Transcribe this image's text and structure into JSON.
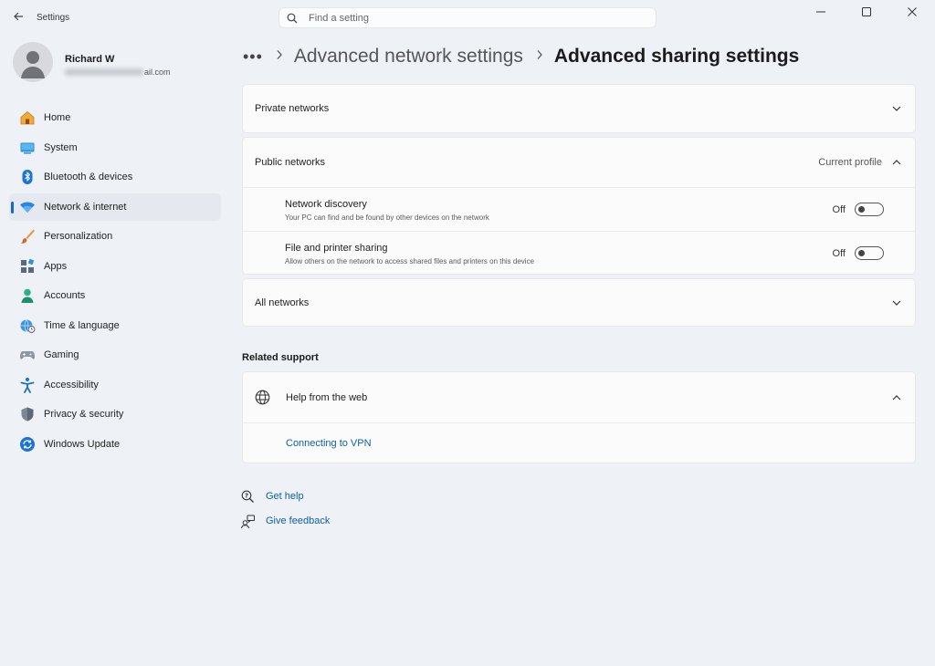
{
  "window": {
    "title": "Settings",
    "back_icon": "back-arrow-icon",
    "controls": [
      "minimize-icon",
      "maximize-icon",
      "close-icon"
    ]
  },
  "search": {
    "placeholder": "Find a setting"
  },
  "profile": {
    "name": "Richard W",
    "email_visible": "ail.com"
  },
  "sidebar": {
    "items": [
      {
        "label": "Home",
        "icon": "home-icon"
      },
      {
        "label": "System",
        "icon": "system-icon"
      },
      {
        "label": "Bluetooth & devices",
        "icon": "bluetooth-icon"
      },
      {
        "label": "Network & internet",
        "icon": "wifi-icon",
        "active": true
      },
      {
        "label": "Personalization",
        "icon": "brush-icon"
      },
      {
        "label": "Apps",
        "icon": "apps-icon"
      },
      {
        "label": "Accounts",
        "icon": "accounts-icon"
      },
      {
        "label": "Time & language",
        "icon": "globe-clock-icon"
      },
      {
        "label": "Gaming",
        "icon": "gamepad-icon"
      },
      {
        "label": "Accessibility",
        "icon": "accessibility-icon"
      },
      {
        "label": "Privacy & security",
        "icon": "shield-icon"
      },
      {
        "label": "Windows Update",
        "icon": "update-icon"
      }
    ]
  },
  "breadcrumb": {
    "dots": "•••",
    "parent": "Advanced network settings",
    "current": "Advanced sharing settings"
  },
  "sections": {
    "private_networks": {
      "label": "Private networks",
      "expanded": false
    },
    "public_networks": {
      "label": "Public networks",
      "badge": "Current profile",
      "expanded": true,
      "settings": [
        {
          "title": "Network discovery",
          "description": "Your PC can find and be found by other devices on the network",
          "state_label": "Off",
          "on": false
        },
        {
          "title": "File and printer sharing",
          "description": "Allow others on the network to access shared files and printers on this device",
          "state_label": "Off",
          "on": false
        }
      ]
    },
    "all_networks": {
      "label": "All networks",
      "expanded": false
    }
  },
  "related_support": {
    "heading": "Related support",
    "help_from_web": {
      "label": "Help from the web",
      "icon": "globe-icon",
      "expanded": true
    },
    "links": [
      {
        "label": "Connecting to VPN"
      }
    ]
  },
  "footer_links": [
    {
      "label": "Get help",
      "icon": "get-help-icon"
    },
    {
      "label": "Give feedback",
      "icon": "feedback-icon"
    }
  ],
  "colors": {
    "accent": "#1467c6",
    "link": "#0d5ea8",
    "background": "#eef2f7",
    "card": "#fbfbfc"
  }
}
